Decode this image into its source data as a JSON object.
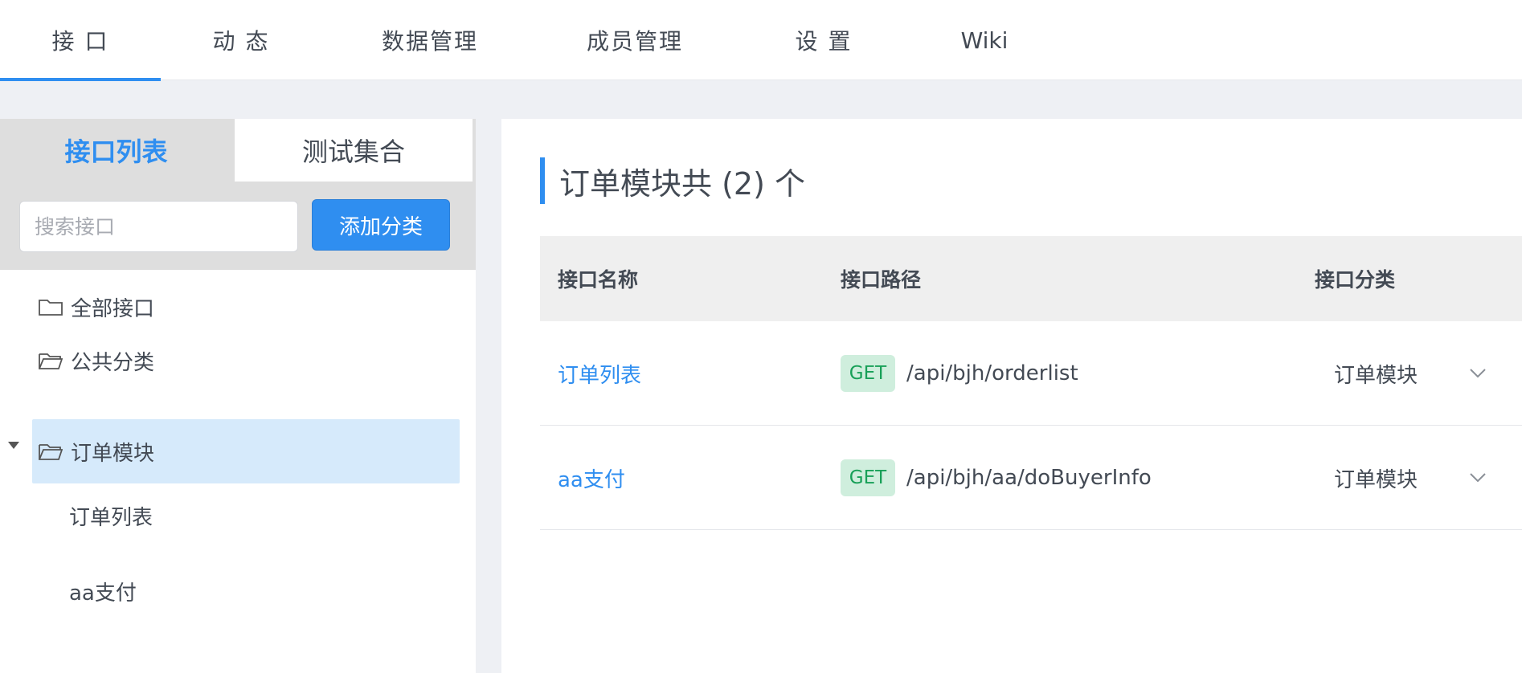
{
  "nav": {
    "tabs": [
      {
        "label": "接 口",
        "active": true
      },
      {
        "label": "动 态"
      },
      {
        "label": "数据管理"
      },
      {
        "label": "成员管理"
      },
      {
        "label": "设 置"
      },
      {
        "label": "Wiki"
      }
    ]
  },
  "sidebar": {
    "tabs": [
      "接口列表",
      "测试集合"
    ],
    "search_placeholder": "搜索接口",
    "add_category_label": "添加分类",
    "tree": {
      "all": "全部接口",
      "public": "公共分类",
      "order_module": "订单模块",
      "children": [
        "订单列表",
        "aa支付"
      ]
    }
  },
  "main": {
    "title": "订单模块共 (2) 个",
    "columns": [
      "接口名称",
      "接口路径",
      "接口分类"
    ],
    "rows": [
      {
        "name": "订单列表",
        "method": "GET",
        "path": "/api/bjh/orderlist",
        "category": "订单模块"
      },
      {
        "name": "aa支付",
        "method": "GET",
        "path": "/api/bjh/aa/doBuyerInfo",
        "category": "订单模块"
      }
    ]
  },
  "colors": {
    "accent": "#2f8ef0",
    "selected_bg": "#d6eafb",
    "get_tag_bg": "#cfeedd",
    "get_tag_text": "#18a058"
  }
}
